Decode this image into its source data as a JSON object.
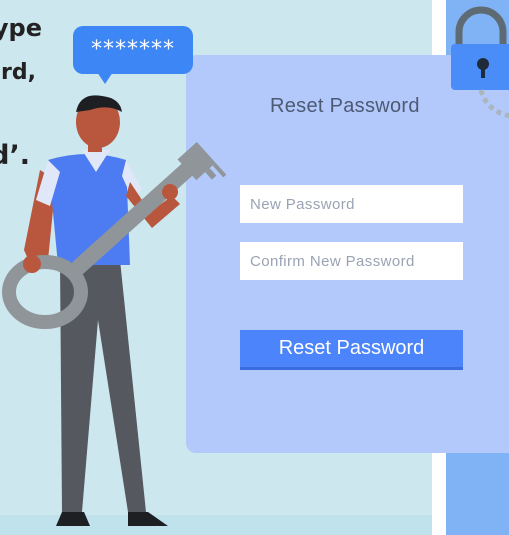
{
  "instruction": {
    "line1_fragment": "ype",
    "line2_fragment": "rd,",
    "line3_fragment": "d’."
  },
  "speech_bubble": {
    "text": "*******"
  },
  "form": {
    "title": "Reset Password",
    "new_password": {
      "value": "",
      "placeholder": "New Password"
    },
    "confirm_password": {
      "value": "",
      "placeholder": "Confirm New Password"
    },
    "submit_label": "Reset Password"
  },
  "icons": {
    "padlock": "lock-icon",
    "key": "key-illustration"
  },
  "colors": {
    "background": "#cde7ef",
    "card": "#b3c9fb",
    "button": "#4c84fb",
    "bubble": "#3c87f5",
    "lock_body": "#4b8df8",
    "lock_shackle": "#5f6b74"
  }
}
